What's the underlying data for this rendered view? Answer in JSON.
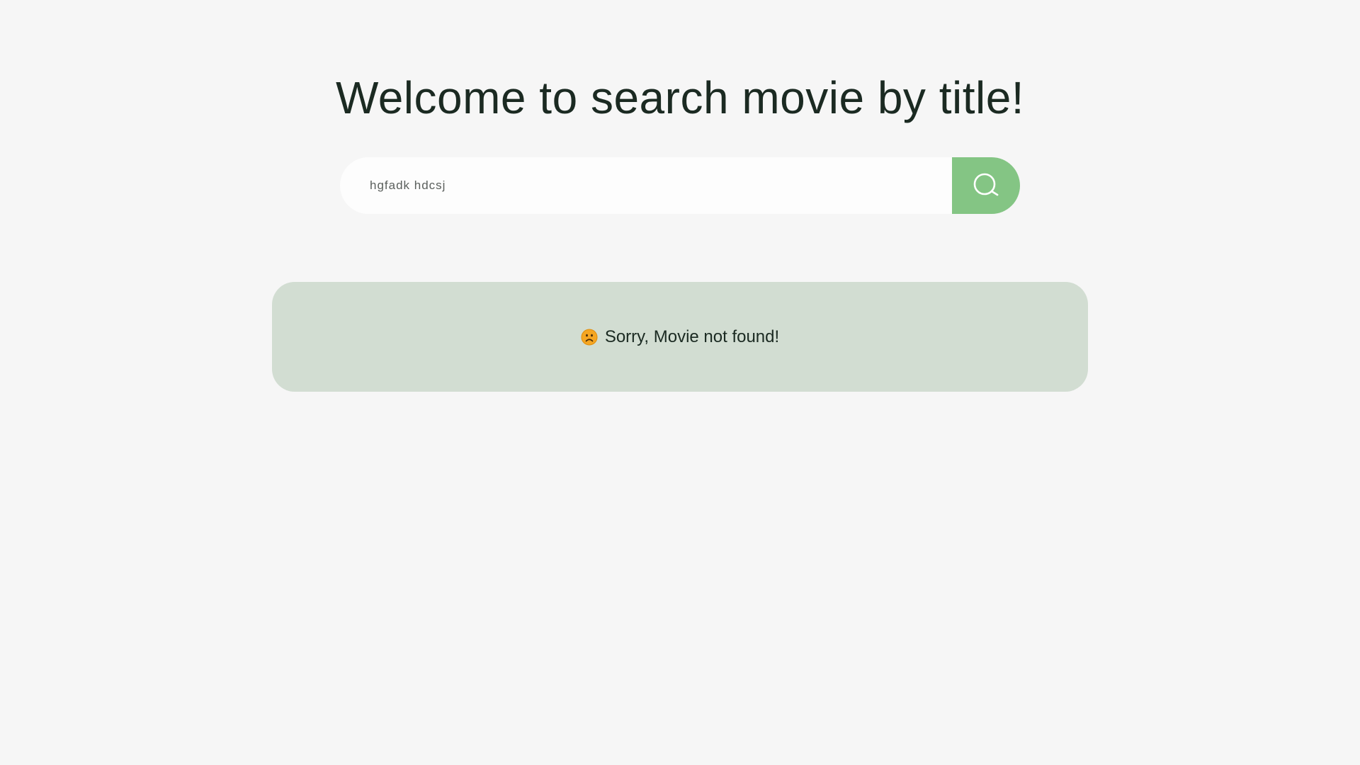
{
  "header": {
    "title": "Welcome to search movie by title!"
  },
  "search": {
    "value": "hgfadk hdcsj",
    "button_icon": "search-icon"
  },
  "result": {
    "message": "Sorry, Movie not found!",
    "icon": "sad-face-icon"
  },
  "colors": {
    "background": "#f6f6f6",
    "accent": "#84c584",
    "panel": "#d2ddd2",
    "text": "#1b2a22"
  }
}
